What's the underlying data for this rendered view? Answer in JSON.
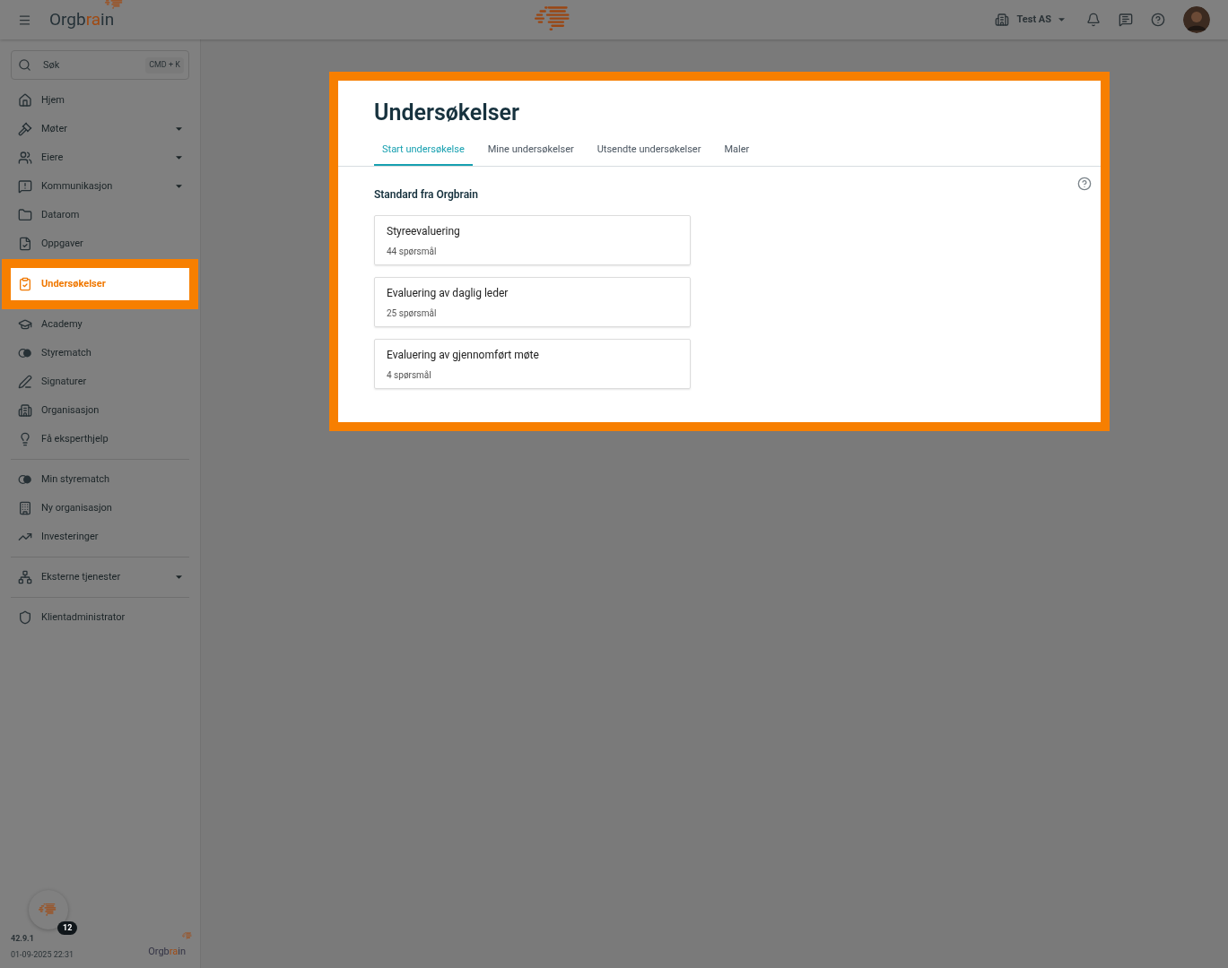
{
  "top_bar": {
    "logo": "Orgbrain",
    "company": "Test AS"
  },
  "search": {
    "placeholder": "Søk",
    "shortcut": "CMD + K"
  },
  "sidebar": {
    "groups": [
      [
        {
          "label": "Hjem",
          "expandable": false,
          "selected": false
        },
        {
          "label": "Møter",
          "expandable": true,
          "selected": false
        },
        {
          "label": "Eiere",
          "expandable": true,
          "selected": false
        },
        {
          "label": "Kommunikasjon",
          "expandable": true,
          "selected": false
        },
        {
          "label": "Datarom",
          "expandable": false,
          "selected": false
        },
        {
          "label": "Oppgaver",
          "expandable": false,
          "selected": false
        },
        {
          "label": "Undersøkelser",
          "expandable": false,
          "selected": true
        },
        {
          "label": "Academy",
          "expandable": false,
          "selected": false
        },
        {
          "label": "Styrematch",
          "expandable": false,
          "selected": false
        },
        {
          "label": "Signaturer",
          "expandable": false,
          "selected": false
        },
        {
          "label": "Organisasjon",
          "expandable": false,
          "selected": false
        },
        {
          "label": "Få eksperthjelp",
          "expandable": false,
          "selected": false
        }
      ],
      [
        {
          "label": "Min styrematch",
          "expandable": false,
          "selected": false
        },
        {
          "label": "Ny organisasjon",
          "expandable": false,
          "selected": false
        },
        {
          "label": "Investeringer",
          "expandable": false,
          "selected": false
        }
      ],
      [
        {
          "label": "Eksterne tjenester",
          "expandable": true,
          "selected": false
        }
      ],
      [
        {
          "label": "Klientadministrator",
          "expandable": false,
          "selected": false
        }
      ]
    ]
  },
  "footer": {
    "badge": "12",
    "version": "42.9.1",
    "timestamp": "01-09-2025 22:31",
    "logo": "Orgbrain"
  },
  "panel": {
    "highlighted": true,
    "title": "Undersøkelser",
    "tabs": [
      {
        "label": "Start undersøkelse",
        "selected": true
      },
      {
        "label": "Mine undersøkelser",
        "selected": false
      },
      {
        "label": "Utsendte undersøkelser",
        "selected": false
      },
      {
        "label": "Maler",
        "selected": false
      }
    ],
    "section_title": "Standard fra Orgbrain",
    "surveys": [
      {
        "title": "Styreevaluering",
        "subtitle": "44 spørsmål"
      },
      {
        "title": "Evaluering av daglig leder",
        "subtitle": "25 spørsmål"
      },
      {
        "title": "Evaluering av gjennomført møte",
        "subtitle": "4 spørsmål"
      }
    ]
  }
}
